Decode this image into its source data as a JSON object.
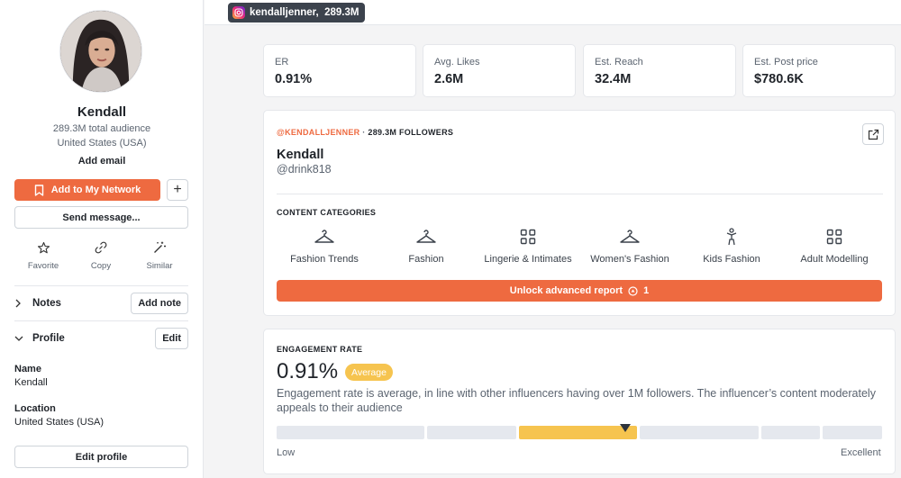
{
  "profile": {
    "name": "Kendall",
    "audience": "289.3M total audience",
    "location": "United States (USA)",
    "add_email": "Add email",
    "add_network_label": "Add to My Network",
    "plus_label": "+",
    "send_message_label": "Send message...",
    "actions": [
      {
        "label": "Favorite",
        "icon": "star-icon"
      },
      {
        "label": "Copy",
        "icon": "link-icon"
      },
      {
        "label": "Similar",
        "icon": "magic-wand-icon"
      }
    ],
    "notes": {
      "title": "Notes",
      "button": "Add note"
    },
    "profile_section": {
      "title": "Profile",
      "button": "Edit"
    },
    "fields": [
      {
        "label": "Name",
        "value": "Kendall"
      },
      {
        "label": "Location",
        "value": "United States (USA)"
      }
    ],
    "edit_profile_label": "Edit profile"
  },
  "topbar": {
    "handle_chip": "kendalljenner,  289.3M"
  },
  "stats": [
    {
      "label": "ER",
      "value": "0.91%"
    },
    {
      "label": "Avg. Likes",
      "value": "2.6M"
    },
    {
      "label": "Est. Reach",
      "value": "32.4M"
    },
    {
      "label": "Est. Post price",
      "value": "$780.6K"
    }
  ],
  "account": {
    "handle": "@KENDALLJENNER",
    "separator": " · ",
    "followers": "289.3M FOLLOWERS",
    "name": "Kendall",
    "sub_handle": "@drink818",
    "categories_title": "CONTENT CATEGORIES",
    "categories": [
      {
        "label": "Fashion Trends",
        "icon": "hanger-icon"
      },
      {
        "label": "Fashion",
        "icon": "hanger-icon"
      },
      {
        "label": "Lingerie & Intimates",
        "icon": "grid-icon"
      },
      {
        "label": "Women's Fashion",
        "icon": "hanger-icon"
      },
      {
        "label": "Kids Fashion",
        "icon": "child-icon"
      },
      {
        "label": "Adult Modelling",
        "icon": "grid-icon"
      }
    ],
    "unlock_label": "Unlock advanced report",
    "unlock_count": "1"
  },
  "engagement": {
    "title": "ENGAGEMENT RATE",
    "value": "0.91%",
    "badge": "Average",
    "description": "Engagement rate is average, in line with other influencers having over 1M followers. The influencer’s content moderately appeals to their audience",
    "scale_low": "Low",
    "scale_high": "Excellent",
    "active_segment": 2,
    "segment_count": 6
  },
  "colors": {
    "accent": "#ee6a40",
    "average": "#f6c44f",
    "chip_bg": "#3c434d"
  }
}
